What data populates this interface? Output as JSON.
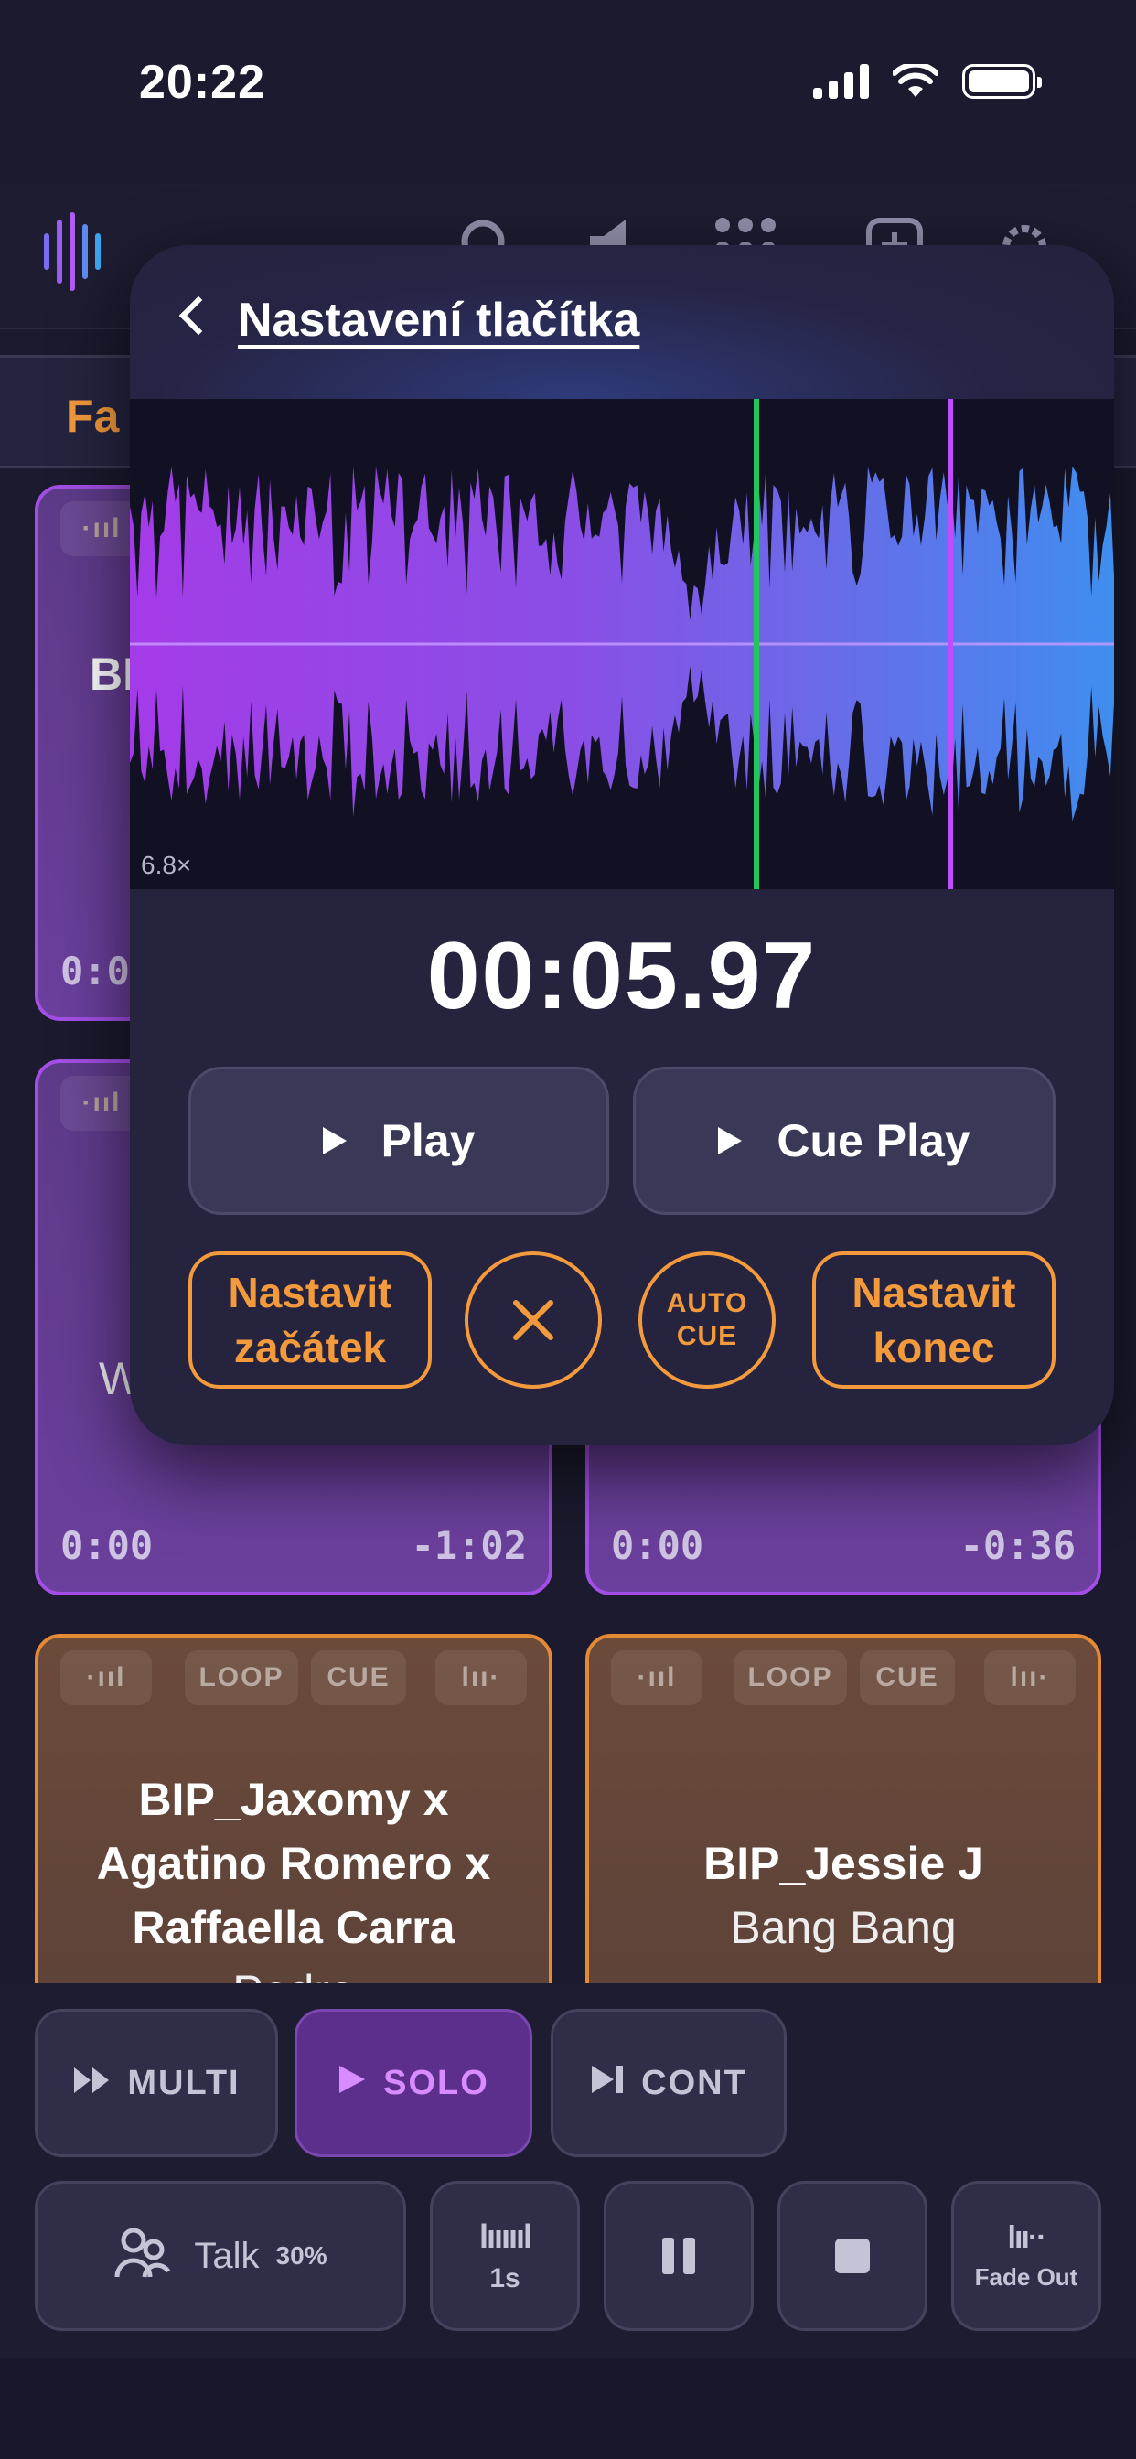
{
  "status": {
    "time": "20:22"
  },
  "favorites_tab": {
    "label": "Fa"
  },
  "pads": [
    {
      "title": "BI",
      "elapsed": "0:0",
      "color": "purple"
    },
    {
      "title": "W",
      "elapsed": "0:00",
      "remaining": "-1:02",
      "color": "purple"
    },
    {
      "elapsed": "0:00",
      "remaining": "-0:36",
      "color": "purple"
    },
    {
      "title_lines": [
        "BIP_Jaxomy x",
        "Agatino Romero x",
        "Raffaella Carra"
      ],
      "sub": "Pedro",
      "loop": "LOOP",
      "cue": "CUE",
      "color": "orange"
    },
    {
      "title_lines": [
        "BIP_Jessie J"
      ],
      "sub": "Bang Bang",
      "loop": "LOOP",
      "cue": "CUE",
      "color": "orange"
    }
  ],
  "modal": {
    "title": "Nastavení tlačítka",
    "zoom": "6.8×",
    "timecode": "00:05.97",
    "play_label": "Play",
    "cue_play_label": "Cue Play",
    "set_start": [
      "Nastavit",
      "začátek"
    ],
    "set_end": [
      "Nastavit",
      "konec"
    ],
    "auto_cue": [
      "AUTO",
      "CUE"
    ],
    "cue_marker_color": "#22c55e",
    "end_marker_color": "#c04bff"
  },
  "modes": {
    "multi": "MULTI",
    "solo": "SOLO",
    "cont": "CONT"
  },
  "controls": {
    "talk": "Talk",
    "talk_level": "30%",
    "fade_time": "1s",
    "fade_out": "Fade Out"
  },
  "colors": {
    "accent_orange": "#f39a3c",
    "accent_purple": "#c04bff",
    "background": "#1b1a2e"
  }
}
